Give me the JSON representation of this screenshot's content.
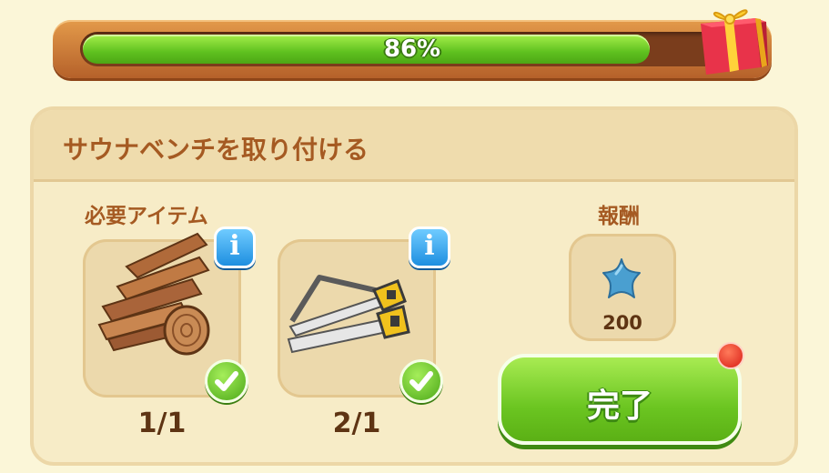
{
  "progress": {
    "percent_label": "86%",
    "fraction": 0.86
  },
  "task": {
    "title": "サウナベンチを取り付ける",
    "required_items_label": "必要アイテム",
    "reward_label": "報酬",
    "items": [
      {
        "icon": "wood-planks-icon",
        "info_label": "i",
        "count": "1/1",
        "complete": true
      },
      {
        "icon": "saws-icon",
        "info_label": "i",
        "count": "2/1",
        "complete": true
      }
    ],
    "reward": {
      "icon": "blue-star-icon",
      "value": "200"
    },
    "complete_button_label": "完了"
  },
  "colors": {
    "accent_green": "#6bc521",
    "title_brown": "#a55a22",
    "info_blue": "#1e8fe0",
    "notification_red": "#d91e16"
  }
}
